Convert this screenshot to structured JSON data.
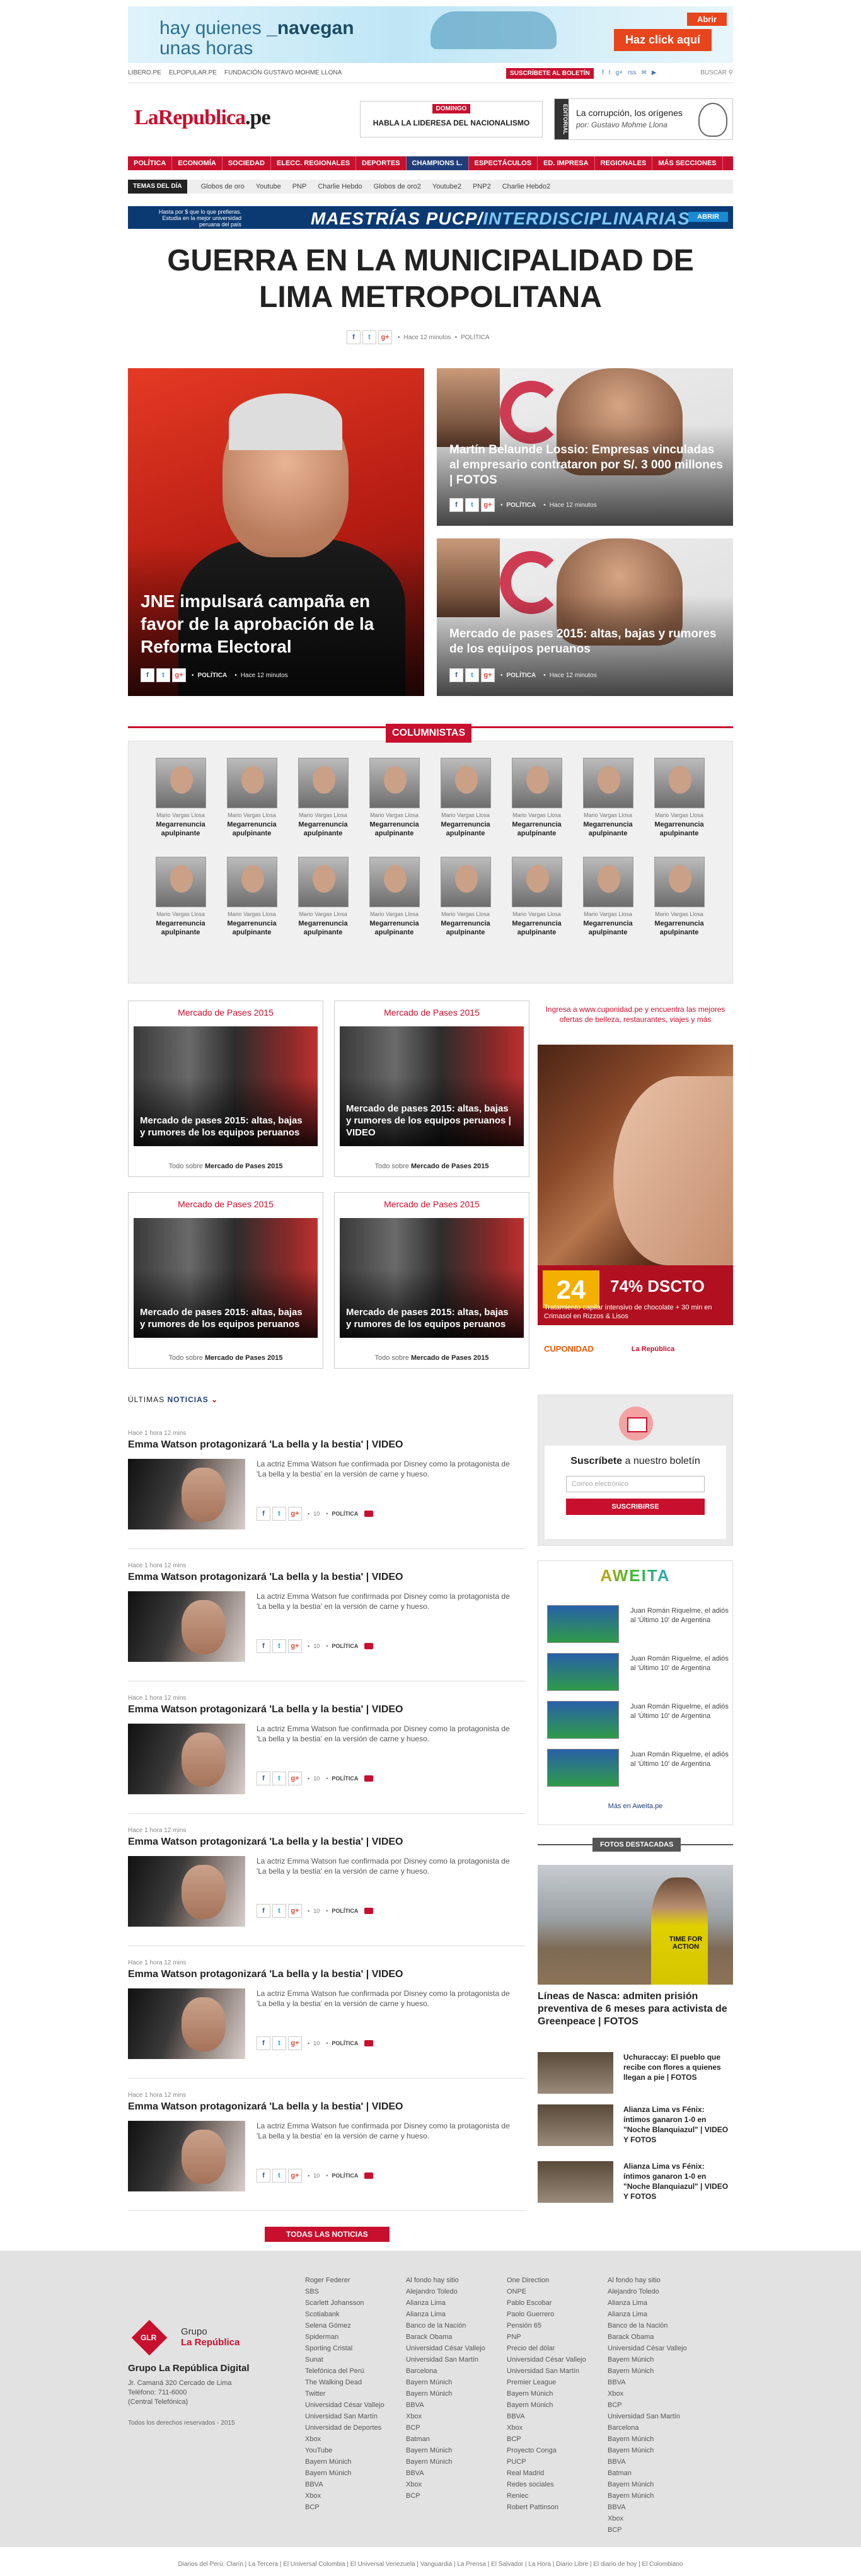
{
  "top_ad": {
    "line1_a": "hay quienes ",
    "line1_b": "_navegan",
    "line2": "unas horas",
    "open": "Abrir",
    "cta": "Haz click aquí"
  },
  "util": {
    "links": [
      "LIBERO.PE",
      "ELPOPULAR.PE",
      "FUNDACIÓN GUSTAVO MOHME LLONA"
    ],
    "subscribe": "SUSCRÍBETE AL BOLETÍN",
    "social": [
      "f",
      "t",
      "g+",
      "rss",
      "✉",
      "▶"
    ],
    "search": "BUSCAR"
  },
  "header": {
    "logo_a": "LaRepublica",
    "logo_b": ".pe",
    "domingo": "DOMINGO",
    "domingo_title": "HABLA LA LIDERESA DEL NACIONALISMO",
    "editorial_tag": "EDITORIAL",
    "editorial_title": "La corrupción, los orígenes",
    "editorial_author": "por: Gustavo Mohme Llona"
  },
  "nav": [
    "POLÍTICA",
    "ECONOMÍA",
    "SOCIEDAD",
    "ELECC. REGIONALES",
    "DEPORTES",
    "CHAMPIONS L.",
    "ESPECTÁCULOS",
    "ED. IMPRESA",
    "REGIONALES",
    "MÁS SECCIONES"
  ],
  "temas": {
    "label": "TEMAS DEL DÍA",
    "items": [
      "Globos de oro",
      "Youtube",
      "PNP",
      "Charlie Hebdo",
      "Globos de oro2",
      "Youtube2",
      "PNP2",
      "Charlie Hebdo2"
    ]
  },
  "pucp": {
    "left": "Hasta por $ que lo que prefieras. Estudia en la mejor universidad peruana del país",
    "main_a": "MAESTRÍAS PUCP/",
    "main_b": "INTERDISCIPLINARIAS",
    "open": "ABRIR"
  },
  "headline": {
    "title": "GUERRA EN LA MUNICIPALIDAD DE LIMA METROPOLITANA",
    "time": "Hace 12 minutos",
    "category": "POLÍTICA"
  },
  "hero": {
    "main": {
      "title": "JNE impulsará campaña en favor de la aprobación de la Reforma Electoral",
      "category": "POLÍTICA",
      "time": "Hace 12 minutos"
    },
    "side": [
      {
        "title": "Martín Belaunde Lossio: Empresas vinculadas al empresario contrataron por S/. 3 000 millones | FOTOS",
        "category": "POLÍTICA",
        "time": "Hace 12 minutos"
      },
      {
        "title": "Mercado de pases 2015: altas, bajas y rumores de los equipos peruanos",
        "category": "POLÍTICA",
        "time": "Hace 12 minutos"
      }
    ]
  },
  "columnistas": {
    "heading": "COLUMNISTAS",
    "items": [
      {
        "name": "Mario Vargas Llosa",
        "title": "Megarrenuncia apulpinante"
      },
      {
        "name": "Mario Vargas Llosa",
        "title": "Megarrenuncia apulpinante"
      },
      {
        "name": "Mario Vargas Llosa",
        "title": "Megarrenuncia apulpinante"
      },
      {
        "name": "Mario Vargas Llosa",
        "title": "Megarrenuncia apulpinante"
      },
      {
        "name": "Mario Vargas Llosa",
        "title": "Megarrenuncia apulpinante"
      },
      {
        "name": "Mario Vargas Llosa",
        "title": "Megarrenuncia apulpinante"
      },
      {
        "name": "Mario Vargas Llosa",
        "title": "Megarrenuncia apulpinante"
      },
      {
        "name": "Mario Vargas Llosa",
        "title": "Megarrenuncia apulpinante"
      },
      {
        "name": "Mario Vargas Llosa",
        "title": "Megarrenuncia apulpinante"
      },
      {
        "name": "Mario Vargas Llosa",
        "title": "Megarrenuncia apulpinante"
      },
      {
        "name": "Mario Vargas Llosa",
        "title": "Megarrenuncia apulpinante"
      },
      {
        "name": "Mario Vargas Llosa",
        "title": "Megarrenuncia apulpinante"
      },
      {
        "name": "Mario Vargas Llosa",
        "title": "Megarrenuncia apulpinante"
      },
      {
        "name": "Mario Vargas Llosa",
        "title": "Megarrenuncia apulpinante"
      },
      {
        "name": "Mario Vargas Llosa",
        "title": "Megarrenuncia apulpinante"
      },
      {
        "name": "Mario Vargas Llosa",
        "title": "Megarrenuncia apulpinante"
      }
    ]
  },
  "mercado": [
    {
      "head": "Mercado de Pases 2015",
      "title": "Mercado de pases 2015: altas, bajas y rumores de los equipos peruanos",
      "foot_a": "Todo sobre ",
      "foot_b": "Mercado de Pases 2015"
    },
    {
      "head": "Mercado de Pases 2015",
      "title": "Mercado de pases 2015: altas, bajas y rumores de los equipos peruanos | VIDEO",
      "foot_a": "Todo sobre ",
      "foot_b": "Mercado de Pases 2015"
    },
    {
      "head": "Mercado de Pases 2015",
      "title": "Mercado de pases 2015: altas, bajas y rumores de los equipos peruanos",
      "foot_a": "Todo sobre ",
      "foot_b": "Mercado de Pases 2015"
    },
    {
      "head": "Mercado de Pases 2015",
      "title": "Mercado de pases 2015: altas, bajas y rumores de los equipos peruanos",
      "foot_a": "Todo sobre ",
      "foot_b": "Mercado de Pases 2015"
    }
  ],
  "cuponidad": {
    "text": "Ingresa a www.cuponidad.pe y encuentra las mejores ofertas de belleza, restaurantes, viajes y más",
    "price": "24",
    "discount": "74% DSCTO",
    "desc": "Tratamiento capilar intensivo de chocolate + 30 min en Crimasol en Rizzos & Lisos",
    "logo1": "CUPONIDAD",
    "logo2": "La República"
  },
  "ultimas": {
    "heading_a": "ÚLTIMAS ",
    "heading_b": "NOTICIAS",
    "more": "TODAS LAS NOTICIAS",
    "items": [
      {
        "time": "Hace 1 hora 12 mins",
        "title": "Emma Watson protagonizará 'La bella y la bestia' | VIDEO",
        "excerpt": "La actriz Emma Watson fue confirmada por Disney como la protagonista de 'La bella y la bestia' en la versión de carne y hueso.",
        "comments": "10",
        "category": "POLÍTICA"
      },
      {
        "time": "Hace 1 hora 12 mins",
        "title": "Emma Watson protagonizará 'La bella y la bestia' | VIDEO",
        "excerpt": "La actriz Emma Watson fue confirmada por Disney como la protagonista de 'La bella y la bestia' en la versión de carne y hueso.",
        "comments": "10",
        "category": "POLÍTICA"
      },
      {
        "time": "Hace 1 hora 12 mins",
        "title": "Emma Watson protagonizará 'La bella y la bestia' | VIDEO",
        "excerpt": "La actriz Emma Watson fue confirmada por Disney como la protagonista de 'La bella y la bestia' en la versión de carne y hueso.",
        "comments": "10",
        "category": "POLÍTICA"
      },
      {
        "time": "Hace 1 hora 12 mins",
        "title": "Emma Watson protagonizará 'La bella y la bestia' | VIDEO",
        "excerpt": "La actriz Emma Watson fue confirmada por Disney como la protagonista de 'La bella y la bestia' en la versión de carne y hueso.",
        "comments": "10",
        "category": "POLÍTICA"
      },
      {
        "time": "Hace 1 hora 12 mins",
        "title": "Emma Watson protagonizará 'La bella y la bestia' | VIDEO",
        "excerpt": "La actriz Emma Watson fue confirmada por Disney como la protagonista de 'La bella y la bestia' en la versión de carne y hueso.",
        "comments": "10",
        "category": "POLÍTICA"
      },
      {
        "time": "Hace 1 hora 12 mins",
        "title": "Emma Watson protagonizará 'La bella y la bestia' | VIDEO",
        "excerpt": "La actriz Emma Watson fue confirmada por Disney como la protagonista de 'La bella y la bestia' en la versión de carne y hueso.",
        "comments": "10",
        "category": "POLÍTICA"
      }
    ]
  },
  "boletin": {
    "title_a": "Suscríbete",
    "title_b": " a nuestro boletín",
    "placeholder": "Correo electrónico",
    "button": "SUSCRIBIRSE"
  },
  "aweita": {
    "logo": "AWEITA",
    "items": [
      "Juan Román Riquelme, el adiós al 'Último 10' de Argentina",
      "Juan Román Riquelme, el adiós al 'Último 10' de Argentina",
      "Juan Román Riquelme, el adiós al 'Último 10' de Argentina",
      "Juan Román Riquelme, el adiós al 'Último 10' de Argentina"
    ],
    "more": "Más en Aweita.pe"
  },
  "fotos": {
    "heading": "FOTOS DESTACADAS",
    "sign": "TIME FOR ACTION",
    "caption": "Líneas de Nasca: admiten prisión preventiva de 6 meses para activista de Greenpeace | FOTOS",
    "items": [
      "Uchuraccay: El pueblo que recibe con flores a quienes llegan a pie | FOTOS",
      "Alianza Lima vs Fénix: íntimos ganaron 1-0 en \"Noche Blanquiazul\" | VIDEO Y FOTOS",
      "Alianza Lima vs Fénix: íntimos ganaron 1-0 en \"Noche Blanquiazul\" | VIDEO Y FOTOS"
    ]
  },
  "footer": {
    "glr": "GLR",
    "grupo": "Grupo",
    "la_rep": "La República",
    "name": "Grupo La República Digital",
    "address": "Jr. Camaná 320 Cercado de Lima",
    "phone": "Teléfono: 711-6000",
    "central": "(Central Telefónica)",
    "copyright": "Todos los derechos reservados - 2015",
    "col1": [
      "Roger Federer",
      "SBS",
      "Scarlett Johansson",
      "Scotiabank",
      "Selena Gómez",
      "Spiderman",
      "Sporting Cristal",
      "Sunat",
      "Telefónica del Perú",
      "The Walking Dead",
      "Twitter",
      "Universidad César Vallejo",
      "Universidad San Martín",
      "Universidad de Deportes",
      "Xbox",
      "YouTube",
      "Bayern Múnich",
      "Bayern Múnich",
      "BBVA",
      "Xbox",
      "BCP"
    ],
    "col2": [
      "Al fondo hay sitio",
      "Alejandro Toledo",
      "Alianza Lima",
      "Alianza Lima",
      "Banco de la Nación",
      "Barack Obama",
      "Universidad César Vallejo",
      "Universidad San Martín",
      "Barcelona",
      "Bayern Múnich",
      "Bayern Múnich",
      "BBVA",
      "Xbox",
      "BCP",
      "Batman",
      "Bayern Múnich",
      "Bayern Múnich",
      "BBVA",
      "Xbox",
      "BCP"
    ],
    "col3": [
      "One Direction",
      "ONPE",
      "Pablo Escobar",
      "Paolo Guerrero",
      "Pensión 65",
      "PNP",
      "Precio del dólar",
      "Universidad César Vallejo",
      "Universidad San Martín",
      "Premier League",
      "Bayern Múnich",
      "Bayern Múnich",
      "BBVA",
      "Xbox",
      "BCP",
      "Proyecto Conga",
      "PUCP",
      "Real Madrid",
      "Redes sociales",
      "Reniec",
      "Robert Pattinson"
    ],
    "col4": [
      "Al fondo hay sitio",
      "Alejandro Toledo",
      "Alianza Lima",
      "Alianza Lima",
      "Banco de la Nación",
      "Barack Obama",
      "Universidad César Vallejo",
      "Bayern Múnich",
      "Bayern Múnich",
      "BBVA",
      "Xbox",
      "BCP",
      "Universidad San Martín",
      "Barcelona",
      "Bayern Múnich",
      "Bayern Múnich",
      "BBVA",
      "Batman",
      "Bayern Múnich",
      "Bayern Múnich",
      "BBVA",
      "Xbox",
      "BCP"
    ]
  },
  "bottom": "Diarios del Perú: Clarín | La Tercera | El Universal Colombia | El Universal Venezuela | Vanguardia | La Prensa | El Salvador | La Hora | Diario Libre | El diario de hoy | El Colombiano"
}
